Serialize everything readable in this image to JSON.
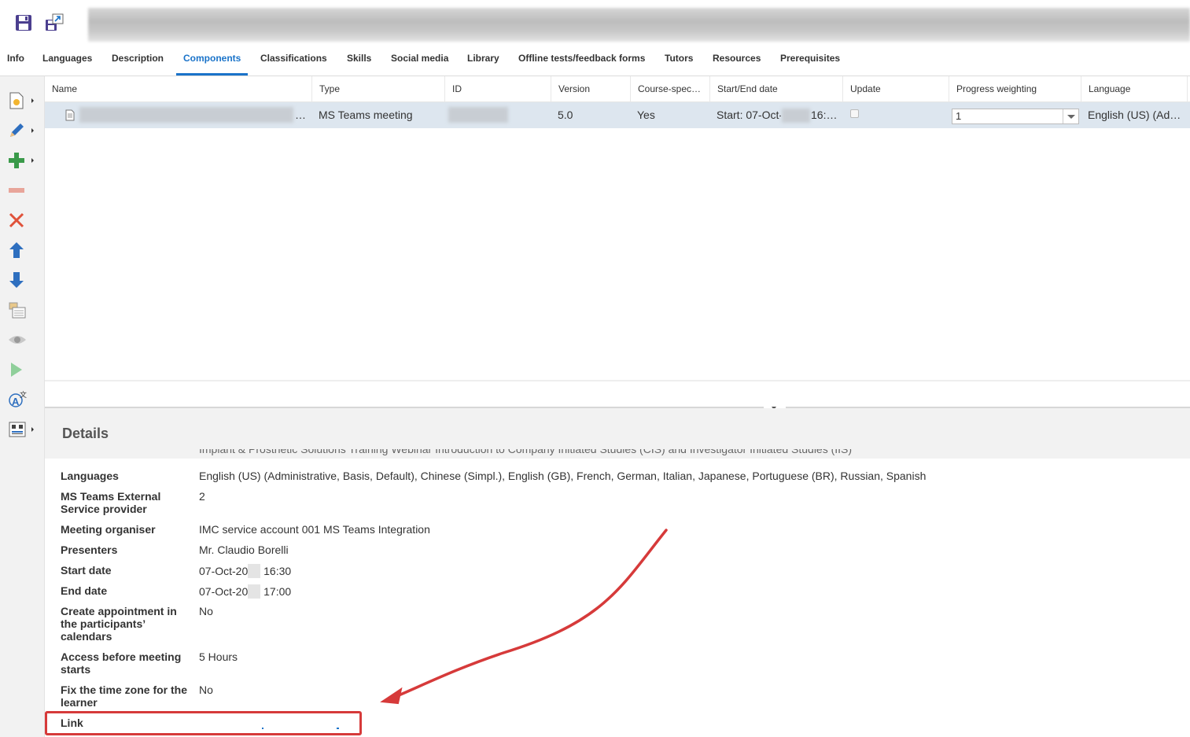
{
  "tabs": [
    "Info",
    "Languages",
    "Description",
    "Components",
    "Classifications",
    "Skills",
    "Social media",
    "Library",
    "Offline tests/feedback forms",
    "Tutors",
    "Resources",
    "Prerequisites"
  ],
  "active_tab": "Components",
  "grid": {
    "columns": [
      "Name",
      "Type",
      "ID",
      "Version",
      "Course-spec…",
      "Start/End date",
      "Update",
      "Progress weighting",
      "Language"
    ],
    "row": {
      "name_suffix": "…",
      "type": "MS Teams meeting",
      "version": "5.0",
      "course_specific": "Yes",
      "start_end_prefix": "Start: 07-Oct-",
      "start_end_suffix": "16:…",
      "progress_weighting": "1",
      "language": "English (US) (Ad…"
    }
  },
  "details": {
    "title": "Details",
    "partial_row_text": "Implant & Prosthetic Solutions Training Webinar Introduction to Company Initiated Studies (CIS) and Investigator Initiated Studies (IIS)",
    "fields": [
      {
        "label": "Languages",
        "value": "English (US) (Administrative, Basis, Default), Chinese (Simpl.), English (GB), French, German, Italian, Japanese, Portuguese (BR), Russian, Spanish"
      },
      {
        "label": "MS Teams External Service provider",
        "value": "2"
      },
      {
        "label": "Meeting organiser",
        "value": "IMC service account 001 MS Teams Integration"
      },
      {
        "label": "Presenters",
        "value": "Mr. Claudio Borelli"
      },
      {
        "label": "Start date",
        "value_prefix": "07-Oct-20",
        "value_suffix": "16:30"
      },
      {
        "label": "End date",
        "value_prefix": "07-Oct-20",
        "value_suffix": "17:00"
      },
      {
        "label": "Create appointment in the participants’ calendars",
        "value": "No"
      },
      {
        "label": "Access before meeting starts",
        "value": "5 Hours"
      },
      {
        "label": "Fix the time zone for the learner",
        "value": "No"
      },
      {
        "label": "Link",
        "value": ""
      }
    ]
  },
  "colors": {
    "accent": "#1a73c9",
    "annotation": "#d63a3a",
    "selected_row": "#dde6ef"
  }
}
